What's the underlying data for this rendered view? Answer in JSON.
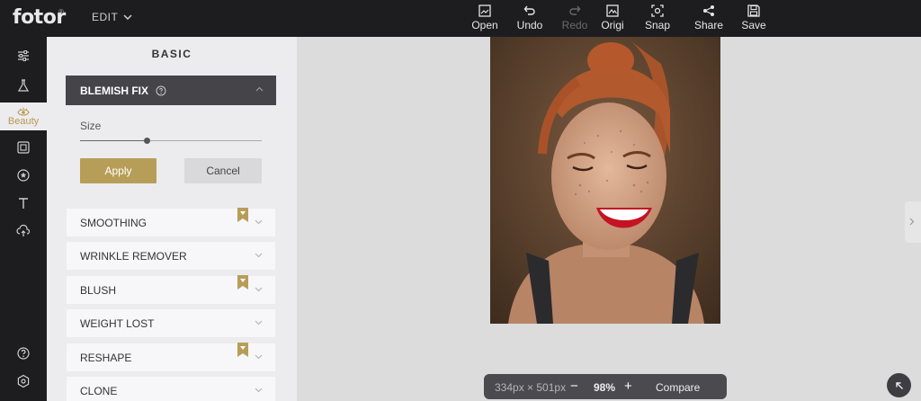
{
  "app": {
    "logo": "fotor",
    "logo_mark": "®",
    "menu_label": "EDIT"
  },
  "toolbar": [
    {
      "id": "open",
      "label": "Open",
      "icon": "open-icon",
      "disabled": false
    },
    {
      "id": "undo",
      "label": "Undo",
      "icon": "undo-icon",
      "disabled": false
    },
    {
      "id": "redo",
      "label": "Redo",
      "icon": "redo-icon",
      "disabled": true
    },
    {
      "id": "original",
      "label": "Origi",
      "icon": "original-icon",
      "disabled": false
    },
    {
      "id": "snap",
      "label": "Snap",
      "icon": "snap-icon",
      "disabled": false
    },
    {
      "id": "share",
      "label": "Share",
      "icon": "share-icon",
      "disabled": false
    },
    {
      "id": "save",
      "label": "Save",
      "icon": "save-icon",
      "disabled": false
    }
  ],
  "rail": {
    "items": [
      "adjust-icon",
      "effects-icon",
      "beauty-icon",
      "frames-icon",
      "stickers-icon",
      "text-icon",
      "cloud-icon",
      "help-icon",
      "settings-icon"
    ],
    "active_label": "Beauty"
  },
  "panel": {
    "title": "BASIC",
    "active_section": "BLEMISH FIX",
    "size_label": "Size",
    "size_value": 0.37,
    "apply_label": "Apply",
    "cancel_label": "Cancel",
    "sections": [
      {
        "label": "SMOOTHING",
        "premium": true
      },
      {
        "label": "WRINKLE REMOVER",
        "premium": false
      },
      {
        "label": "BLUSH",
        "premium": true
      },
      {
        "label": "WEIGHT LOST",
        "premium": false
      },
      {
        "label": "RESHAPE",
        "premium": true
      },
      {
        "label": "CLONE",
        "premium": false
      }
    ]
  },
  "status": {
    "dimensions": "334px × 501px",
    "zoom": "98%",
    "minus": "−",
    "plus": "+",
    "compare": "Compare"
  },
  "colors": {
    "accent": "#b79e58",
    "dark": "#1d1d20",
    "panel": "#ececef",
    "canvas": "#dcdcdc"
  }
}
